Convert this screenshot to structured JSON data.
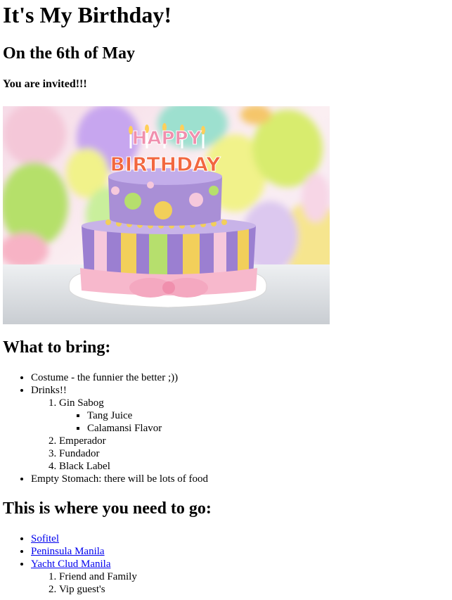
{
  "header": {
    "title": "It's My Birthday!",
    "date": "On the 6th of May",
    "invite": "You are invited!!!"
  },
  "hero": {
    "banner_top": "HAPPY",
    "banner_bottom": "BIRTHDAY",
    "colors": {
      "cake_top": "#a98fd6",
      "cake_bottom_stripe_a": "#9b7fd1",
      "cake_bottom_stripe_b": "#f2cf5a",
      "ribbon": "#f7b8cc",
      "balloons": [
        "#f1f28a",
        "#b5e06a",
        "#c7a6ef",
        "#f7b3c5",
        "#9de0cf",
        "#f5c66a"
      ]
    }
  },
  "bring": {
    "heading": "What to bring:",
    "item_costume": "Costume - the funnier the better ;))",
    "item_drinks": "Drinks!!",
    "drinks": {
      "gin": "Gin Sabog",
      "gin_mixers": [
        "Tang Juice",
        "Calamansi Flavor"
      ],
      "others": [
        "Emperador",
        "Fundador",
        "Black Label"
      ]
    },
    "item_stomach": "Empty Stomach: there will be lots of food"
  },
  "where": {
    "heading": "This is where you need to go:",
    "places": [
      "Sofitel",
      "Peninsula Manila",
      "Yacht Clud Manila"
    ],
    "guests": [
      "Friend and Family",
      "Vip guest's"
    ]
  }
}
